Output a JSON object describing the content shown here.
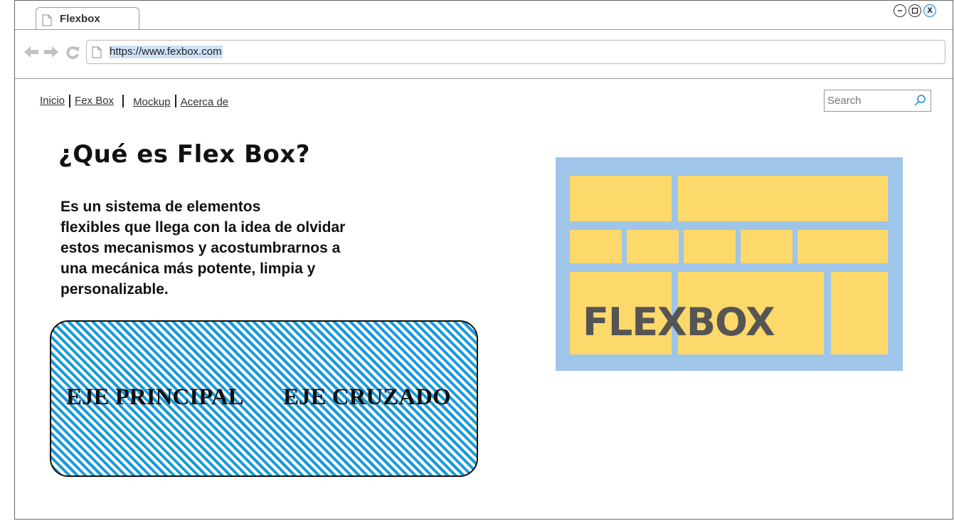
{
  "browser": {
    "tab_title": "Flexbox",
    "url": "https://www.fexbox.com",
    "window_controls": {
      "minimize": "–",
      "maximize": "□",
      "close": "X"
    }
  },
  "nav": {
    "items": [
      {
        "label": "Inicio"
      },
      {
        "label": "Fex Box"
      },
      {
        "label": "Mockup"
      },
      {
        "label": "Acerca de"
      }
    ]
  },
  "search": {
    "placeholder": "Search"
  },
  "main": {
    "heading": "¿Qué es Flex Box?",
    "paragraph_lines": [
      "Es un sistema de elementos",
      "flexibles que llega con la idea de olvidar",
      "estos mecanismos y acostumbrarnos a",
      "una mecánica más potente, limpia y",
      "personalizable."
    ],
    "axis_box": {
      "label_main": "EJE PRINCIPAL",
      "label_cross": "EJE CRUZADO"
    },
    "flexbox_figure": {
      "word": "FLEXBOX"
    }
  },
  "colors": {
    "stripe_blue": "#1a9ad9",
    "figure_background": "#9fc5e8",
    "figure_cells": "#fdd86a",
    "figure_text": "#555555"
  },
  "icons": [
    "document-icon",
    "back-arrow-icon",
    "forward-arrow-icon",
    "reload-icon",
    "search-icon"
  ]
}
